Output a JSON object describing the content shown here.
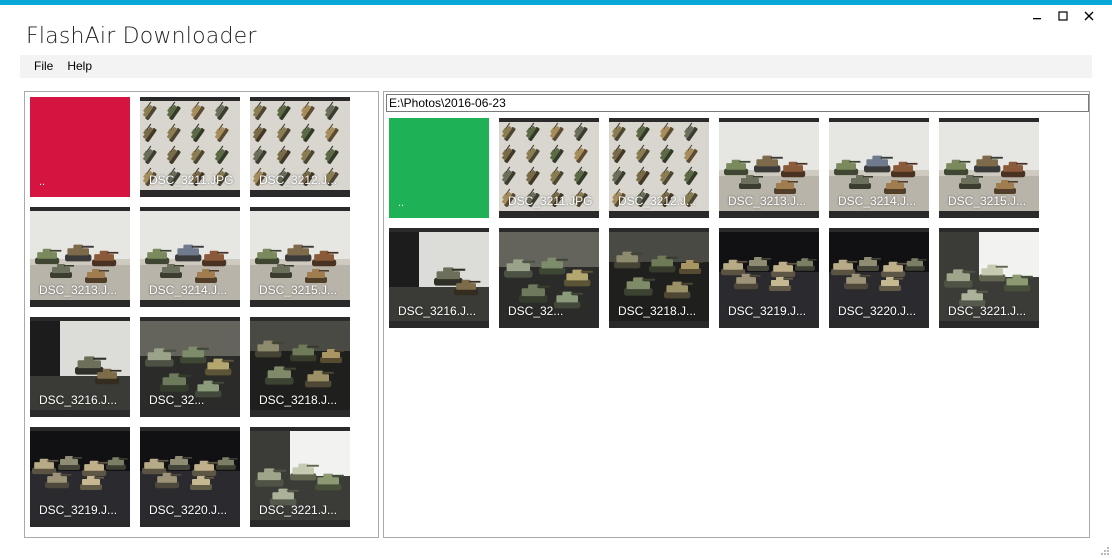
{
  "window": {
    "title": "FlashAir Downloader",
    "accent_color": "#08a7d6",
    "controls": [
      "minimize-icon",
      "maximize-icon",
      "close-icon"
    ]
  },
  "menu": {
    "items": [
      {
        "label": "File"
      },
      {
        "label": "Help"
      }
    ]
  },
  "left_panel": {
    "folder": {
      "label": "..",
      "color": "#d5153f"
    },
    "items": [
      {
        "label": "DSC_3211.JPG",
        "scene": "wall"
      },
      {
        "label": "DSC_3212.J...",
        "scene": "wall"
      },
      {
        "label": "DSC_3213.J...",
        "scene": "shelf"
      },
      {
        "label": "DSC_3214.J...",
        "scene": "shelf-blue"
      },
      {
        "label": "DSC_3215.J...",
        "scene": "shelf"
      },
      {
        "label": "DSC_3216.J...",
        "scene": "dark-corner"
      },
      {
        "label": "DSC_32...",
        "scene": "blur-green"
      },
      {
        "label": "DSC_3218.J...",
        "scene": "blur-dark"
      },
      {
        "label": "DSC_3219.J...",
        "scene": "dark-table"
      },
      {
        "label": "DSC_3220.J...",
        "scene": "dark-table"
      },
      {
        "label": "DSC_3221.J...",
        "scene": "window-light"
      }
    ]
  },
  "right_panel": {
    "path": "E:\\Photos\\2016-06-23",
    "folder": {
      "label": "..",
      "color": "#1eb156"
    },
    "items": [
      {
        "label": "DSC_3211.JPG",
        "scene": "wall"
      },
      {
        "label": "DSC_3212.J...",
        "scene": "wall"
      },
      {
        "label": "DSC_3213.J...",
        "scene": "shelf"
      },
      {
        "label": "DSC_3214.J...",
        "scene": "shelf-blue"
      },
      {
        "label": "DSC_3215.J...",
        "scene": "shelf"
      },
      {
        "label": "DSC_3216.J...",
        "scene": "dark-corner"
      },
      {
        "label": "DSC_32...",
        "scene": "blur-green"
      },
      {
        "label": "DSC_3218.J...",
        "scene": "blur-dark"
      },
      {
        "label": "DSC_3219.J...",
        "scene": "dark-table"
      },
      {
        "label": "DSC_3220.J...",
        "scene": "dark-table"
      },
      {
        "label": "DSC_3221.J...",
        "scene": "window-light"
      }
    ]
  }
}
